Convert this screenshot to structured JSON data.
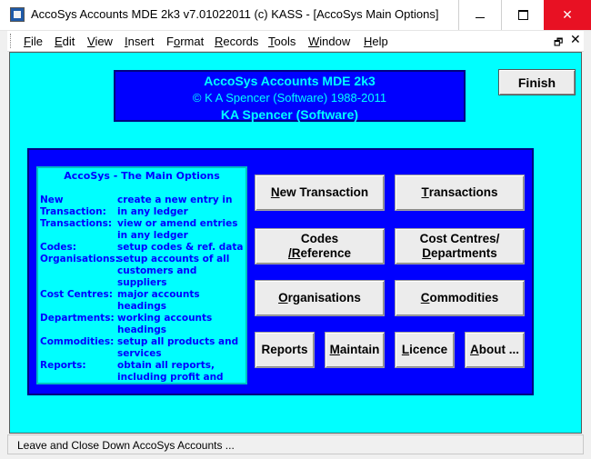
{
  "window": {
    "title": "AccoSys Accounts MDE 2k3 v7.01022011 (c) KASS - [AccoSys Main Options]"
  },
  "menu": {
    "items": [
      {
        "label": "File",
        "accel": "F",
        "rest": "ile"
      },
      {
        "label": "Edit",
        "accel": "E",
        "rest": "dit"
      },
      {
        "label": "View",
        "accel": "V",
        "rest": "iew"
      },
      {
        "label": "Insert",
        "accel": "I",
        "rest": "nsert"
      },
      {
        "label": "Format",
        "accel": "o",
        "pre": "F",
        "rest": "rmat"
      },
      {
        "label": "Records",
        "accel": "R",
        "rest": "ecords"
      },
      {
        "label": "Tools",
        "accel": "T",
        "rest": "ools"
      },
      {
        "label": "Window",
        "accel": "W",
        "rest": "indow"
      },
      {
        "label": "Help",
        "accel": "H",
        "rest": "elp"
      }
    ]
  },
  "header": {
    "line1": "AccoSys Accounts MDE 2k3",
    "line2": "© K A Spencer (Software) 1988-2011",
    "line3": "KA Spencer (Software)"
  },
  "finish": {
    "label": "Finish"
  },
  "help": {
    "title": "AccoSys - The Main Options",
    "rows": [
      {
        "term": "New",
        "desc": "create a new entry in"
      },
      {
        "term": "Transaction:",
        "desc": " in any ledger"
      },
      {
        "term": "Transactions:",
        "desc": "view or amend entries"
      },
      {
        "term": "",
        "desc": "in any ledger"
      },
      {
        "term": "Codes:",
        "desc": "setup codes & ref. data"
      },
      {
        "term": "Organisations:",
        "desc": "setup accounts of all"
      },
      {
        "term": "",
        "desc": "customers and suppliers"
      },
      {
        "term": "Cost Centres:",
        "desc": "major accounts headings"
      },
      {
        "term": "Departments:",
        "desc": "working accounts"
      },
      {
        "term": "",
        "desc": "headings"
      },
      {
        "term": "Commodities:",
        "desc": "setup all products and"
      },
      {
        "term": "",
        "desc": "services"
      },
      {
        "term": "Reports:",
        "desc": "obtain all reports,"
      },
      {
        "term": "",
        "desc": "including profit and loss"
      }
    ]
  },
  "actions": {
    "new_transaction": {
      "accel": "N",
      "rest": "ew Transaction"
    },
    "transactions": {
      "accel": "T",
      "rest": "ransactions"
    },
    "codes_l1": "Codes",
    "codes_accel": "/R",
    "codes_rest": "eference",
    "cost_l1": "Cost Centres/",
    "cost_accel": "D",
    "cost_rest": "epartments",
    "organisations": {
      "accel": "O",
      "rest": "rganisations"
    },
    "commodities": {
      "accel": "C",
      "rest": "ommodities"
    },
    "reports": {
      "label": "Reports"
    },
    "maintain": {
      "accel": "M",
      "rest": "aintain"
    },
    "licence": {
      "accel": "L",
      "rest": "icence"
    },
    "about": {
      "accel": "A",
      "rest": "bout ..."
    }
  },
  "status": {
    "text": "Leave and Close Down AccoSys Accounts ..."
  }
}
